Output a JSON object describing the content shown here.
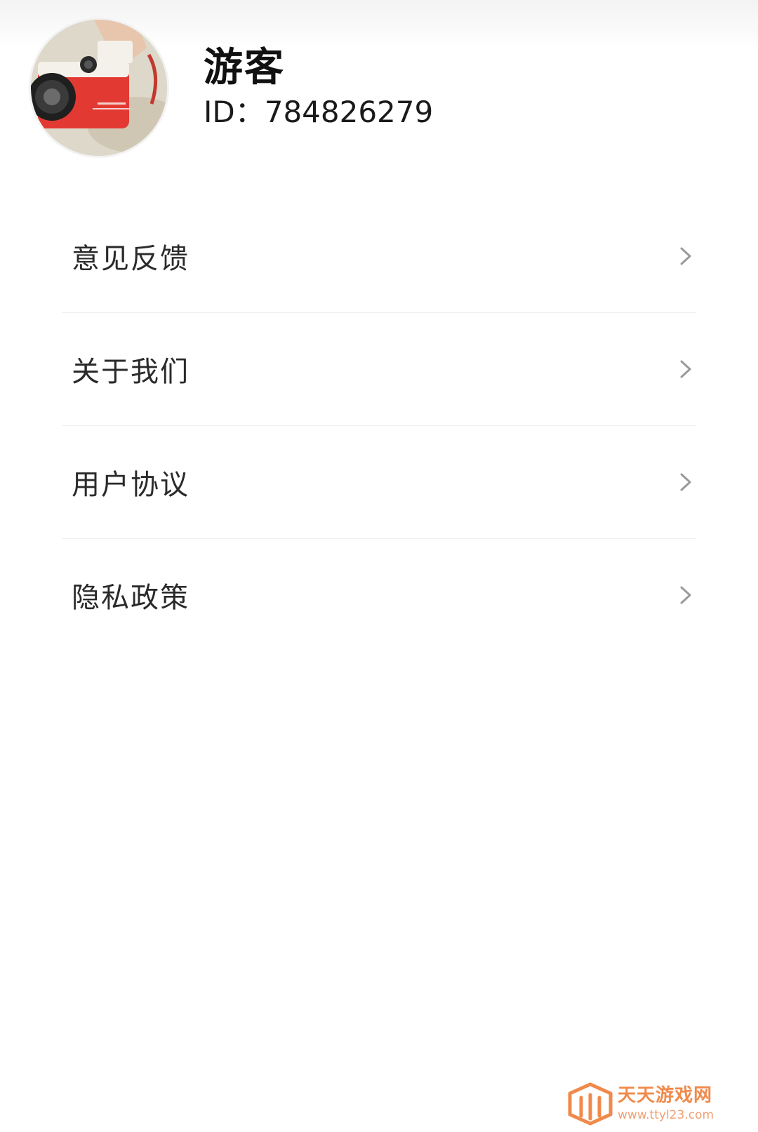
{
  "profile": {
    "name": "游客",
    "id_text": "ID：784826279"
  },
  "menu": {
    "items": [
      {
        "label": "意见反馈",
        "icon": "chevron-right-icon"
      },
      {
        "label": "关于我们",
        "icon": "chevron-right-icon"
      },
      {
        "label": "用户协议",
        "icon": "chevron-right-icon"
      },
      {
        "label": "隐私政策",
        "icon": "chevron-right-icon"
      }
    ]
  },
  "watermark": {
    "title": "天天游戏网",
    "url": "www.ttyl23.com"
  },
  "colors": {
    "background": "#ffffff",
    "text": "#1c1c1c",
    "chevron": "#9a9a9a",
    "divider": "#f0f0f0",
    "watermark": "#f08a4b"
  }
}
